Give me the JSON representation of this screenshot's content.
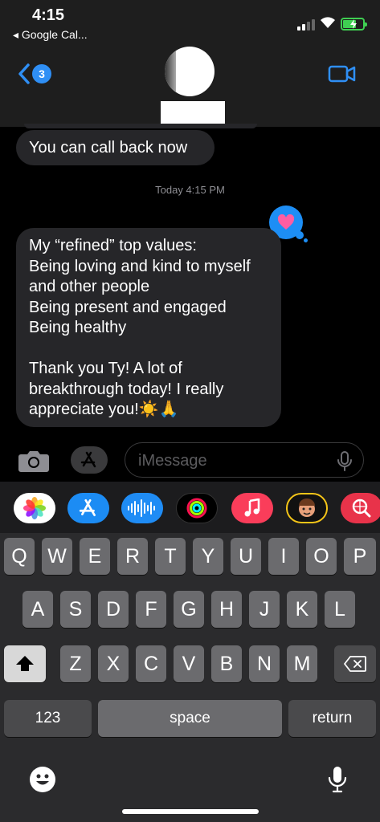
{
  "status_bar": {
    "time": "4:15",
    "back_app": "◂ Google Cal..."
  },
  "header": {
    "unread_count": "3",
    "contact_name": ""
  },
  "messages": [
    {
      "text": "You can call back now"
    },
    {
      "text": "My “refined” top values:\nBeing loving and kind to myself\nand other people\nBeing present and engaged\nBeing healthy\n\nThank you Ty! A lot of\nbreakthrough today! I really\nappreciate you!☀️🙏"
    }
  ],
  "timestamp": "Today 4:15 PM",
  "tapback_icon": "heart-icon",
  "input": {
    "placeholder": "iMessage"
  },
  "app_drawer": [
    {
      "name": "photos-app-icon"
    },
    {
      "name": "app-store-icon"
    },
    {
      "name": "audio-message-icon"
    },
    {
      "name": "fitness-activity-icon"
    },
    {
      "name": "music-icon"
    },
    {
      "name": "memoji-icon"
    },
    {
      "name": "web-search-icon"
    }
  ],
  "keyboard": {
    "row1": [
      "Q",
      "W",
      "E",
      "R",
      "T",
      "Y",
      "U",
      "I",
      "O",
      "P"
    ],
    "row2": [
      "A",
      "S",
      "D",
      "F",
      "G",
      "H",
      "J",
      "K",
      "L"
    ],
    "row3": [
      "Z",
      "X",
      "C",
      "V",
      "B",
      "N",
      "M"
    ],
    "numbers_label": "123",
    "space_label": "space",
    "return_label": "return"
  },
  "colors": {
    "accent_blue": "#2f8ff5",
    "bubble_gray": "#262629",
    "battery_green": "#3fcf52"
  }
}
